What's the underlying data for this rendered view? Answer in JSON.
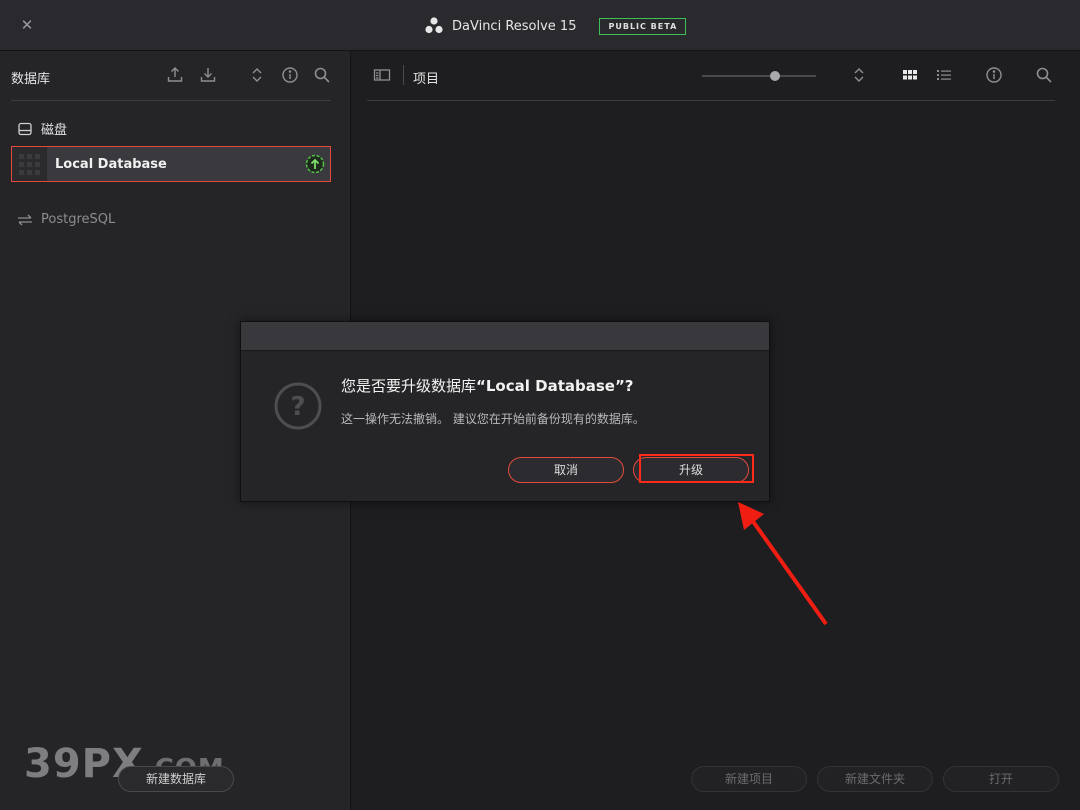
{
  "window": {
    "close_icon": "close-icon",
    "app_title": "DaVinci Resolve 15",
    "badge": "PUBLIC BETA",
    "badge_color": "#3ebf5a"
  },
  "left_panel": {
    "title": "数据库",
    "icons": [
      "upload-icon",
      "download-icon",
      "sort-icon",
      "info-icon",
      "search-icon"
    ],
    "disk_section": "磁盘",
    "database_item": {
      "name": "Local Database",
      "status_icon": "upgrade-icon",
      "selected_border": "#e24a3b"
    },
    "postgresql_label": "PostgreSQL",
    "new_database_button": "新建数据库"
  },
  "right_panel": {
    "title": "项目",
    "icons": [
      "panel-toggle-icon",
      "sort-icon",
      "grid-view-icon",
      "list-view-icon",
      "info-icon",
      "search-icon"
    ],
    "zoom_level": 0.6,
    "new_project_button": "新建项目",
    "new_folder_button": "新建文件夹",
    "open_button": "打开"
  },
  "dialog": {
    "title_prefix": "您是否要升级数据库",
    "title_name": "“Local Database”?",
    "message": "这一操作无法撤销。 建议您在开始前备份现有的数据库。",
    "cancel_button": "取消",
    "upgrade_button": "升级",
    "accent": "#e24a3b"
  },
  "watermark": {
    "main": "39PX",
    "suffix": ".COM"
  }
}
